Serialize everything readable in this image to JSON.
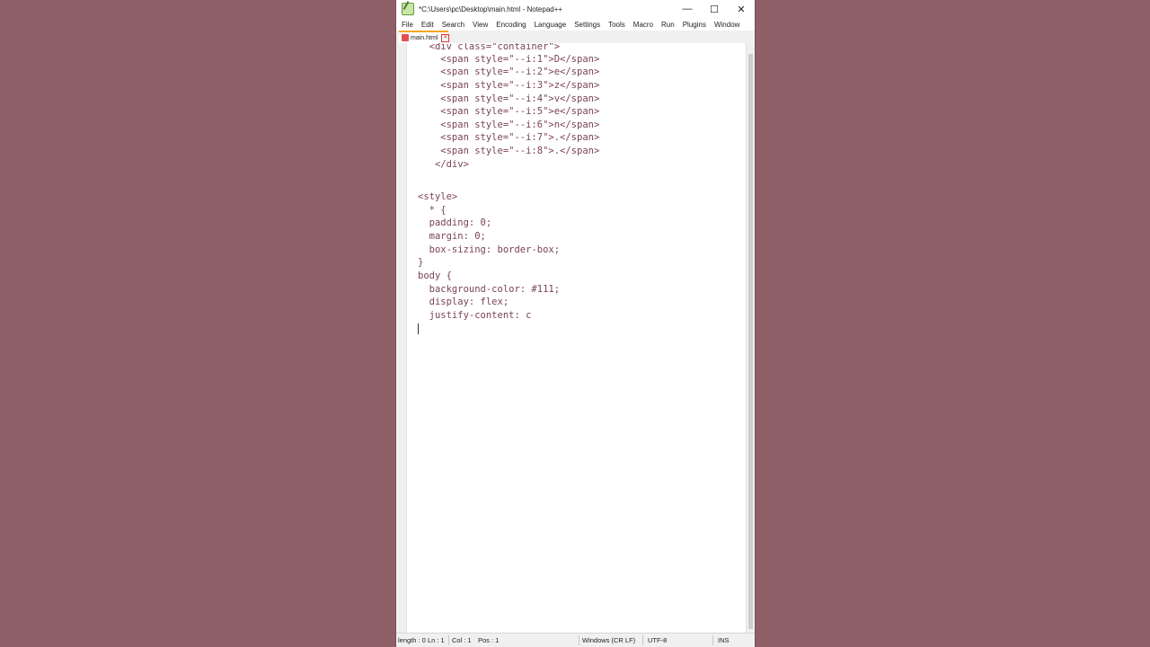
{
  "window": {
    "title": "*C:\\Users\\pc\\Desktop\\main.html - Notepad++",
    "controls": {
      "minimize": "—",
      "maximize": "☐",
      "close": "✕"
    }
  },
  "menu": [
    "File",
    "Edit",
    "Search",
    "View",
    "Encoding",
    "Language",
    "Settings",
    "Tools",
    "Macro",
    "Run",
    "Plugins",
    "Window"
  ],
  "tabs": [
    {
      "label": "main.html",
      "close": "✕"
    }
  ],
  "code_lines": [
    "  <div class=\"container\">",
    "    <span style=\"--i:1\">D</span>",
    "    <span style=\"--i:2\">e</span>",
    "    <span style=\"--i:3\">z</span>",
    "    <span style=\"--i:4\">v</span>",
    "    <span style=\"--i:5\">e</span>",
    "    <span style=\"--i:6\">n</span>",
    "    <span style=\"--i:7\">.</span>",
    "    <span style=\"--i:8\">.</span>",
    "   </div>",
    "",
    "<style>",
    "  * {",
    "  padding: 0;",
    "  margin: 0;",
    "  box-sizing: border-box;",
    "}",
    "body {",
    "  background-color: #111;",
    "  display: flex;",
    "  justify-content: c",
    ""
  ],
  "status": {
    "length_lines": "length : 0  Ln : 1",
    "col": "Col : 1",
    "pos": "Pos : 1",
    "eol": "Windows (CR LF)",
    "encoding": "UTF-8",
    "mode": "INS"
  }
}
